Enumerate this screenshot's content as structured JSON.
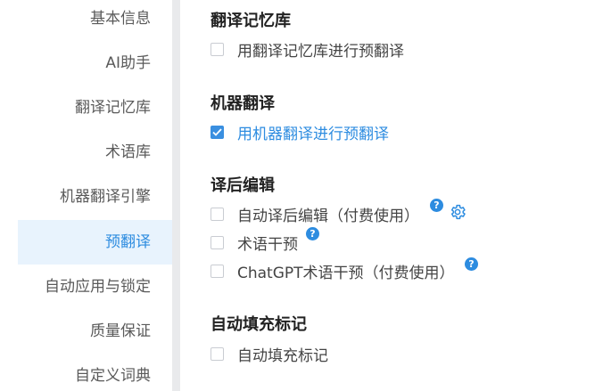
{
  "sidebar": {
    "items": [
      {
        "label": "基本信息"
      },
      {
        "label": "AI助手"
      },
      {
        "label": "翻译记忆库"
      },
      {
        "label": "术语库"
      },
      {
        "label": "机器翻译引擎"
      },
      {
        "label": "预翻译",
        "active": true
      },
      {
        "label": "自动应用与锁定"
      },
      {
        "label": "质量保证"
      },
      {
        "label": "自定义词典"
      }
    ]
  },
  "main": {
    "sections": [
      {
        "title": "翻译记忆库",
        "options": [
          {
            "label": "用翻译记忆库进行预翻译",
            "checked": false
          }
        ]
      },
      {
        "title": "机器翻译",
        "options": [
          {
            "label": "用机器翻译进行预翻译",
            "checked": true
          }
        ]
      },
      {
        "title": "译后编辑",
        "options": [
          {
            "label": "自动译后编辑（付费使用）",
            "checked": false,
            "icons": [
              "help-icon",
              "gear-icon"
            ]
          },
          {
            "label": "术语干预",
            "checked": false,
            "icons": [
              "help-icon"
            ]
          },
          {
            "label": "ChatGPT术语干预（付费使用）",
            "checked": false,
            "icons": [
              "help-icon"
            ]
          }
        ]
      },
      {
        "title": "自动填充标记",
        "options": [
          {
            "label": "自动填充标记",
            "checked": false
          }
        ]
      }
    ],
    "help_icon_glyph": "?"
  },
  "colors": {
    "accent": "#2d8ce0",
    "active_bg": "#e8f3fd",
    "divider": "#e9eaec",
    "text": "#444444",
    "heading": "#222222"
  }
}
